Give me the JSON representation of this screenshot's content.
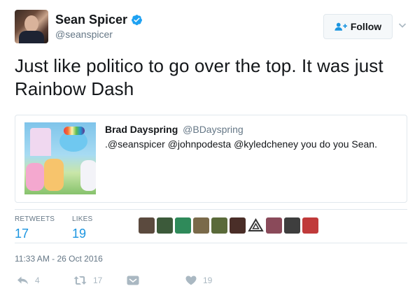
{
  "author": {
    "display_name": "Sean Spicer",
    "handle": "@seanspicer",
    "verified": true
  },
  "follow_button": {
    "label": "Follow"
  },
  "tweet": {
    "text": "Just like politico to go over the top.  It was just Rainbow Dash"
  },
  "quoted_tweet": {
    "display_name": "Brad Dayspring",
    "handle": "@BDayspring",
    "text": ".@seanspicer @johnpodesta @kyledcheney you do you Sean."
  },
  "stats": {
    "retweets_label": "RETWEETS",
    "retweets_count": "17",
    "likes_label": "LIKES",
    "likes_count": "19"
  },
  "likers": [
    "#5b4a3e",
    "#3c5a3a",
    "#2f8a5a",
    "#7a6a4a",
    "#5a6a3a",
    "#4a2e28",
    "#ffffff",
    "#8a4a5a",
    "#3e3e3e",
    "#c03a3a"
  ],
  "timestamp": "11:33 AM - 26 Oct 2016",
  "actions": {
    "reply_count": "4",
    "retweet_count": "17",
    "like_count": "19"
  },
  "colors": {
    "accent": "#1b95e0",
    "muted": "#657786",
    "icon_gray": "#aab8c2",
    "border": "#e1e8ed"
  },
  "icons": [
    "verified-icon",
    "follow-user-icon",
    "chevron-down-icon",
    "reply-icon",
    "retweet-icon",
    "dm-icon",
    "heart-icon"
  ]
}
